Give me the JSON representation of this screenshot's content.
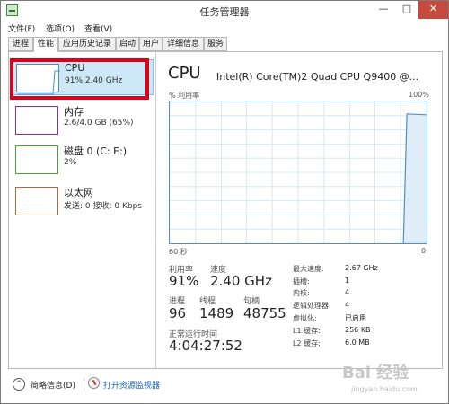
{
  "window": {
    "title": "任务管理器",
    "minimize": "—",
    "maximize": "□",
    "close": "✕"
  },
  "menu": [
    "文件(F)",
    "选项(O)",
    "查看(V)"
  ],
  "tabs": [
    "进程",
    "性能",
    "应用历史记录",
    "启动",
    "用户",
    "详细信息",
    "服务"
  ],
  "sidebar": {
    "items": [
      {
        "name": "CPU",
        "detail": "91% 2.40 GHz",
        "color": "#4a90c8",
        "selected": true
      },
      {
        "name": "内存",
        "detail": "2.6/4.0 GB (65%)",
        "color": "#8b2fa8",
        "selected": false
      },
      {
        "name": "磁盘 0 (C: E:)",
        "detail": "2%",
        "color": "#4f9c3a",
        "selected": false
      },
      {
        "name": "以太网",
        "detail": "发送: 0 接收: 0 Kbps",
        "color": "#b26a3a",
        "selected": false
      }
    ]
  },
  "main": {
    "title": "CPU",
    "model": "Intel(R) Core(TM)2 Quad CPU Q9400 @...",
    "graph": {
      "top_left": "% 利用率",
      "top_right": "100%",
      "bottom_left": "60 秒",
      "bottom_right": "0"
    },
    "utilization_label": "利用率",
    "utilization_value": "91%",
    "speed_label": "速度",
    "speed_value": "2.40 GHz",
    "processes_label": "进程",
    "processes_value": "96",
    "threads_label": "线程",
    "threads_value": "1489",
    "handles_label": "句柄",
    "handles_value": "48755",
    "uptime_label": "正常运行时间",
    "uptime_value": "4:04:27:52",
    "specs": [
      {
        "label": "最大速度:",
        "value": "2.67 GHz"
      },
      {
        "label": "插槽:",
        "value": "1"
      },
      {
        "label": "内核:",
        "value": "4"
      },
      {
        "label": "逻辑处理器:",
        "value": "4"
      },
      {
        "label": "虚拟化:",
        "value": "已启用"
      },
      {
        "label": "L1 缓存:",
        "value": "256 KB"
      },
      {
        "label": "L2 缓存:",
        "value": "6.0 MB"
      }
    ]
  },
  "footer": {
    "fewer_details": "简略信息(D)",
    "open_monitor": "打开资源监视器"
  },
  "watermark": {
    "text": "Bai 经验",
    "sub": "jingyan.baidu.com"
  },
  "colors": {
    "accent": "#4a90c8",
    "selection": "#cce7f6",
    "highlight": "#e0001a"
  }
}
